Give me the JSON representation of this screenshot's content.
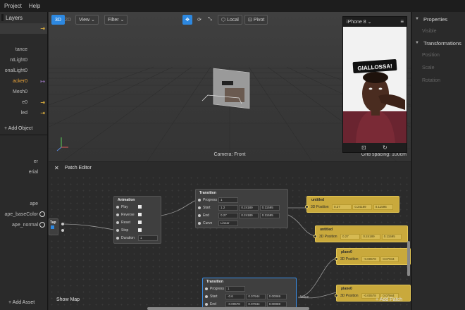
{
  "menubar": {
    "items": [
      "Project",
      "Help"
    ]
  },
  "layers": {
    "title": "Layers",
    "rows": [
      {
        "label": "",
        "icon": "⇥",
        "selected": true
      },
      {
        "label": "",
        "icon": ""
      },
      {
        "label": "tance",
        "icon": ""
      },
      {
        "label": "ntLight0",
        "icon": ""
      },
      {
        "label": "onalLight0",
        "icon": ""
      },
      {
        "label": "acker0",
        "icon": "↦",
        "orange": true
      },
      {
        "label": "Mesh0",
        "icon": ""
      },
      {
        "label": "e0",
        "icon": "⇥"
      },
      {
        "label": "led",
        "icon": "⇥"
      }
    ],
    "add_object": "+ Add Object"
  },
  "assets": {
    "rows": [
      "er",
      "erial",
      "",
      "ape",
      "ape_baseColor",
      "ape_normal"
    ],
    "add_asset": "+ Add Asset"
  },
  "viewport": {
    "btn_3d": "3D",
    "btn_2d": "2D",
    "view": "View ⌄",
    "filter": "Filter ⌄",
    "local": "Local",
    "pivot": "Pivot",
    "camera_label": "Camera: Front",
    "grid_spacing": "Grid spacing: 100cm"
  },
  "phone": {
    "device": "iPhone 8 ⌄",
    "sticker": "GIALLOSSA!",
    "menu": "≡"
  },
  "properties": {
    "title": "Properties",
    "visible": "Visible",
    "transformations": "Transformations",
    "position": "Position",
    "scale": "Scale",
    "rotation": "Rotation"
  },
  "patch_editor": {
    "title": "Patch Editor",
    "show_map": "Show Map",
    "add_patch": "+ Add Patch",
    "tap": {
      "title": "Tap"
    },
    "animation": {
      "title": "Animation",
      "rows": [
        "Play",
        "Reverse",
        "Reset",
        "Stop",
        "Duration"
      ],
      "duration": "1"
    },
    "transition1": {
      "title": "Transition",
      "progress_label": "Progress",
      "progress": "1",
      "start_label": "Start",
      "start": [
        "1.2",
        "0.24189",
        "0.11595"
      ],
      "end_label": "End",
      "end": [
        "0.27",
        "0.24189",
        "0.11595"
      ],
      "curve_label": "Curve",
      "curve": "Linear"
    },
    "transition2": {
      "title": "Transition",
      "progress_label": "Progress",
      "progress": "1",
      "start_label": "Start",
      "start": [
        "-0.6",
        "0.07944",
        "0.00069"
      ],
      "end_label": "End",
      "end": [
        "-0.00578",
        "0.07944",
        "0.00069"
      ],
      "value_label": "Value"
    },
    "yellow": [
      {
        "title": "untitled",
        "label": "3D Position",
        "vals": [
          "0.27",
          "0.24189",
          "0.11595"
        ]
      },
      {
        "title": "untitled",
        "label": "3D Position",
        "vals": [
          "0.27",
          "0.24189",
          "0.11595"
        ]
      },
      {
        "title": "plane0",
        "label": "3D Position",
        "vals": [
          "-0.00578",
          "0.07944",
          "0.00069"
        ]
      },
      {
        "title": "plane0",
        "label": "3D Position",
        "vals": [
          "-0.00578",
          "0.07944",
          "0.00069"
        ]
      }
    ]
  }
}
